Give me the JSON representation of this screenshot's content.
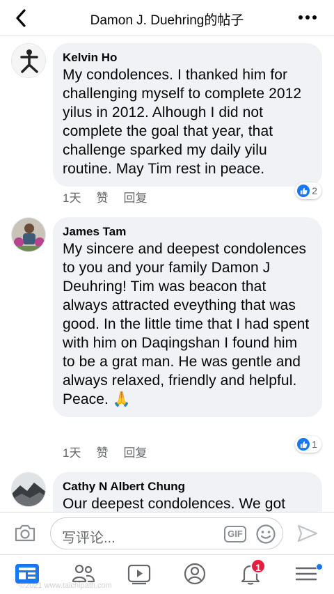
{
  "header": {
    "title": "Damon J. Duehring的帖子",
    "back_icon": "chevron-left-icon",
    "more_icon": "ellipsis-icon"
  },
  "comments": [
    {
      "author": "Kelvin Ho",
      "text": "My condolences. I thanked him for challenging myself to complete 2012 yilus in 2012. Alhough I did not complete the goal that year, that challenge sparked my daily yilu routine. May Tim rest in peace.",
      "time": "1天",
      "like_label": "赞",
      "reply_label": "回复",
      "reaction_count": "2"
    },
    {
      "author": "James Tam",
      "text": "My sincere and deepest condolences to you and your family Damon J Deuhring! Tim was beacon that always attracted eveything that was good. In the little time that I had spent with him on Daqingshan I found him to be a grat man. He was gentle and always relaxed,  friendly and helpful. Peace. 🙏",
      "time": "1天",
      "like_label": "赞",
      "reply_label": "回复",
      "reaction_count": "1"
    },
    {
      "author": "Cathy N Albert Chung",
      "text": "Our deepest condolences.  We got"
    }
  ],
  "composer": {
    "placeholder": "写评论...",
    "gif_label": "GIF"
  },
  "bottom_nav": {
    "notifications_badge": "1",
    "watermark": "©2021 www.taichipath.com"
  },
  "colors": {
    "accent": "#1877f2",
    "bubble": "#f0f2f5",
    "secondary_text": "#65676b",
    "badge": "#e41e3f"
  }
}
